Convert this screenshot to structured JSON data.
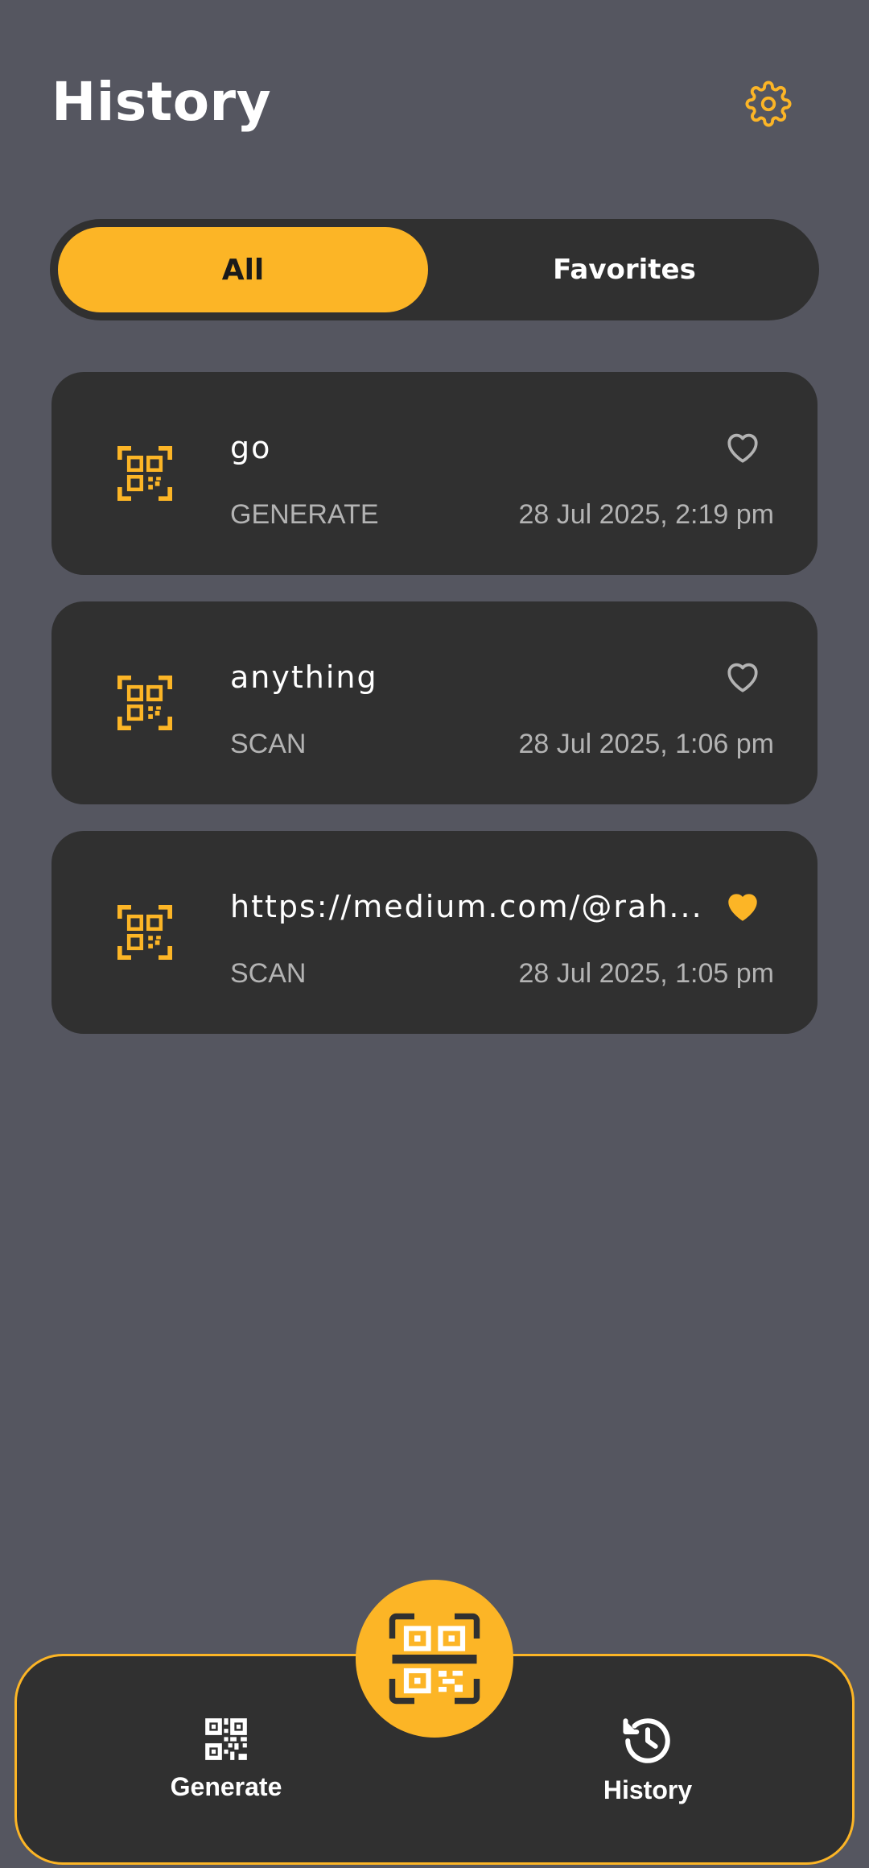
{
  "header": {
    "title": "History",
    "settings_icon": "gear-icon"
  },
  "tabs": {
    "all_label": "All",
    "favorites_label": "Favorites",
    "active": "All"
  },
  "items": [
    {
      "title": "go",
      "type": "GENERATE",
      "date": "28 Jul 2025, 2:19 pm",
      "favorite": false,
      "icon": "qr-code-icon"
    },
    {
      "title": "anything",
      "type": "SCAN",
      "date": "28 Jul 2025, 1:06 pm",
      "favorite": false,
      "icon": "qr-code-icon"
    },
    {
      "title": "https://medium.com/@rah...",
      "type": "SCAN",
      "date": "28 Jul 2025, 1:05 pm",
      "favorite": true,
      "icon": "qr-code-icon"
    }
  ],
  "bottom_nav": {
    "generate_label": "Generate",
    "history_label": "History",
    "scan_icon": "qr-scan-icon"
  },
  "colors": {
    "accent": "#fcb526",
    "background": "#555660",
    "card": "#303030"
  }
}
